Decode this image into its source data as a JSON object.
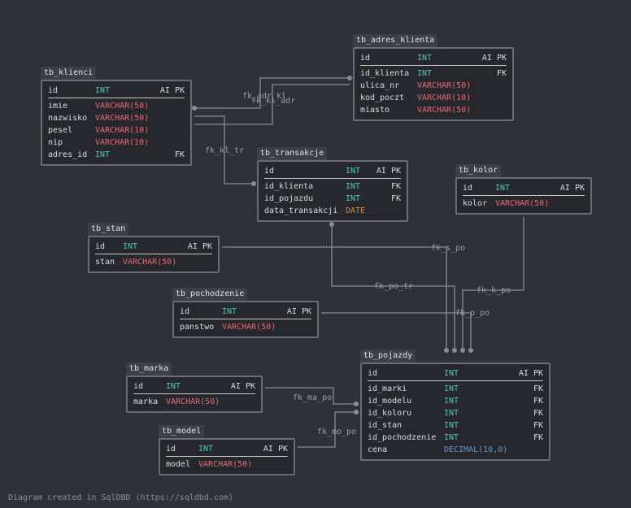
{
  "tables": {
    "tb_klienci": {
      "name": "tb_klienci",
      "columns": [
        {
          "name": "id",
          "type": "INT",
          "flag": "AI PK"
        },
        {
          "name": "imie",
          "type": "VARCHAR(50)",
          "flag": ""
        },
        {
          "name": "nazwisko",
          "type": "VARCHAR(50)",
          "flag": ""
        },
        {
          "name": "pesel",
          "type": "VARCHAR(10)",
          "flag": ""
        },
        {
          "name": "nip",
          "type": "VARCHAR(10)",
          "flag": ""
        },
        {
          "name": "adres_id",
          "type": "INT",
          "flag": "FK"
        }
      ]
    },
    "tb_adres_klienta": {
      "name": "tb_adres_klienta",
      "columns": [
        {
          "name": "id",
          "type": "INT",
          "flag": "AI PK"
        },
        {
          "name": "id_klienta",
          "type": "INT",
          "flag": "FK"
        },
        {
          "name": "ulica_nr",
          "type": "VARCHAR(50)",
          "flag": ""
        },
        {
          "name": "kod_poczt",
          "type": "VARCHAR(10)",
          "flag": ""
        },
        {
          "name": "miasto",
          "type": "VARCHAR(50)",
          "flag": ""
        }
      ]
    },
    "tb_transakcje": {
      "name": "tb_transakcje",
      "columns": [
        {
          "name": "id",
          "type": "INT",
          "flag": "AI PK"
        },
        {
          "name": "id_klienta",
          "type": "INT",
          "flag": "FK"
        },
        {
          "name": "id_pojazdu",
          "type": "INT",
          "flag": "FK"
        },
        {
          "name": "data_transakcji",
          "type": "DATE",
          "flag": ""
        }
      ]
    },
    "tb_kolor": {
      "name": "tb_kolor",
      "columns": [
        {
          "name": "id",
          "type": "INT",
          "flag": "AI PK"
        },
        {
          "name": "kolor",
          "type": "VARCHAR(50)",
          "flag": ""
        }
      ]
    },
    "tb_stan": {
      "name": "tb_stan",
      "columns": [
        {
          "name": "id",
          "type": "INT",
          "flag": "AI PK"
        },
        {
          "name": "stan",
          "type": "VARCHAR(50)",
          "flag": ""
        }
      ]
    },
    "tb_pochodzenie": {
      "name": "tb_pochodzenie",
      "columns": [
        {
          "name": "id",
          "type": "INT",
          "flag": "AI PK"
        },
        {
          "name": "panstwo",
          "type": "VARCHAR(50)",
          "flag": ""
        }
      ]
    },
    "tb_marka": {
      "name": "tb_marka",
      "columns": [
        {
          "name": "id",
          "type": "INT",
          "flag": "AI PK"
        },
        {
          "name": "marka",
          "type": "VARCHAR(50)",
          "flag": ""
        }
      ]
    },
    "tb_model": {
      "name": "tb_model",
      "columns": [
        {
          "name": "id",
          "type": "INT",
          "flag": "AI PK"
        },
        {
          "name": "model",
          "type": "VARCHAR(50)",
          "flag": ""
        }
      ]
    },
    "tb_pojazdy": {
      "name": "tb_pojazdy",
      "columns": [
        {
          "name": "id",
          "type": "INT",
          "flag": "AI PK"
        },
        {
          "name": "id_marki",
          "type": "INT",
          "flag": "FK"
        },
        {
          "name": "id_modelu",
          "type": "INT",
          "flag": "FK"
        },
        {
          "name": "id_koloru",
          "type": "INT",
          "flag": "FK"
        },
        {
          "name": "id_stan",
          "type": "INT",
          "flag": "FK"
        },
        {
          "name": "id_pochodzenie",
          "type": "INT",
          "flag": "FK"
        },
        {
          "name": "cena",
          "type": "DECIMAL(10,0)",
          "flag": ""
        }
      ]
    }
  },
  "relations": {
    "fk_adr_kl": "fk_adr_kl",
    "fk_kl_adr": "fk_kl_adr",
    "fk_kl_tr": "fk_kl_tr",
    "fk_s_po": "fk_s_po",
    "fk_po_tr": "fk_po_tr",
    "fk_k_po": "fk_k_po",
    "fk_p_po": "fk_p_po",
    "fk_ma_po": "fk_ma_po",
    "fk_mo_po": "fk_mo_po"
  },
  "footer": "Diagram created in SqlDBD (https://sqldbd.com)",
  "colors": {
    "background": "#2f3138",
    "int": "#4ec9b0",
    "varchar": "#e06c75",
    "date": "#d7884a",
    "decimal": "#5b9bd5"
  }
}
